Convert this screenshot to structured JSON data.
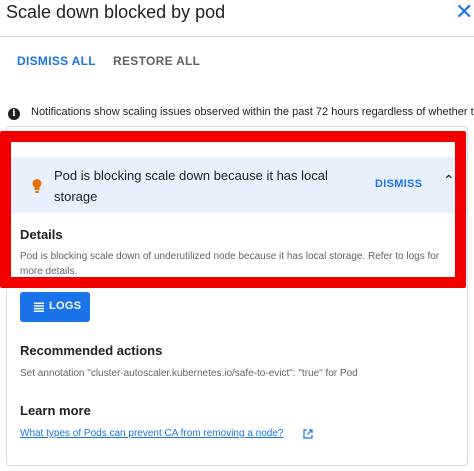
{
  "header": {
    "title": "Scale down blocked by pod",
    "close_icon": "close-icon"
  },
  "actions": {
    "dismiss_all": "DISMISS ALL",
    "restore_all": "RESTORE ALL"
  },
  "info": {
    "icon": "info-icon",
    "text": "Notifications show scaling issues observed within the past 72 hours regardless of whether the issue has resolved"
  },
  "card": {
    "alert": {
      "icon": "lightbulb-icon",
      "icon_color": "#e8710a",
      "text": "Pod is blocking scale down because it has local storage",
      "dismiss": "DISMISS",
      "caret_icon": "chevron-up-icon"
    },
    "details": {
      "heading": "Details",
      "text": "Pod is blocking scale down of underutilized node because it has local storage. Refer to logs for more details."
    },
    "logs_button": {
      "icon": "list-icon",
      "label": "LOGS"
    },
    "recommended": {
      "heading": "Recommended actions",
      "text": "Set annotation \"cluster-autoscaler.kubernetes.io/safe-to-evict\": \"true\" for Pod"
    },
    "learn_more": {
      "heading": "Learn more",
      "link": "What types of Pods can prevent CA from removing a node?",
      "link_icon": "external-link-icon"
    }
  },
  "colors": {
    "accent": "#1a73e8",
    "highlight": "#f20000",
    "alert_background": "#e8f0fe"
  }
}
